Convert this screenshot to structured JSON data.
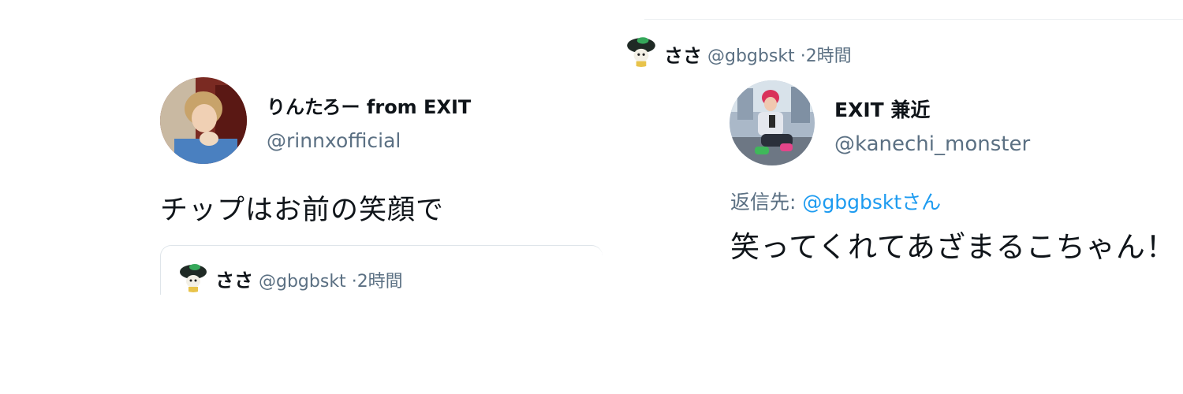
{
  "left_tweet": {
    "display_name": "りんたろー from EXIT",
    "handle": "@rinnxofficial",
    "text": "チップはお前の笑顔で",
    "quoted": {
      "display_name": "ささ",
      "handle": "@gbgbskt",
      "separator": "·",
      "time": "2時間"
    }
  },
  "right_thread": {
    "parent": {
      "display_name": "ささ",
      "handle": "@gbgbskt",
      "separator": "·",
      "time": "2時間"
    },
    "reply": {
      "display_name": "EXIT 兼近",
      "handle": "@kanechi_monster",
      "reply_to_prefix": "返信先: ",
      "reply_to_mention": "@gbgbsktさん",
      "text": "笑ってくれてあざまるこちゃん！"
    }
  },
  "colors": {
    "text": "#0f1419",
    "secondary": "#5b7083",
    "link": "#1d9bf0",
    "border": "#dfe5ea"
  }
}
